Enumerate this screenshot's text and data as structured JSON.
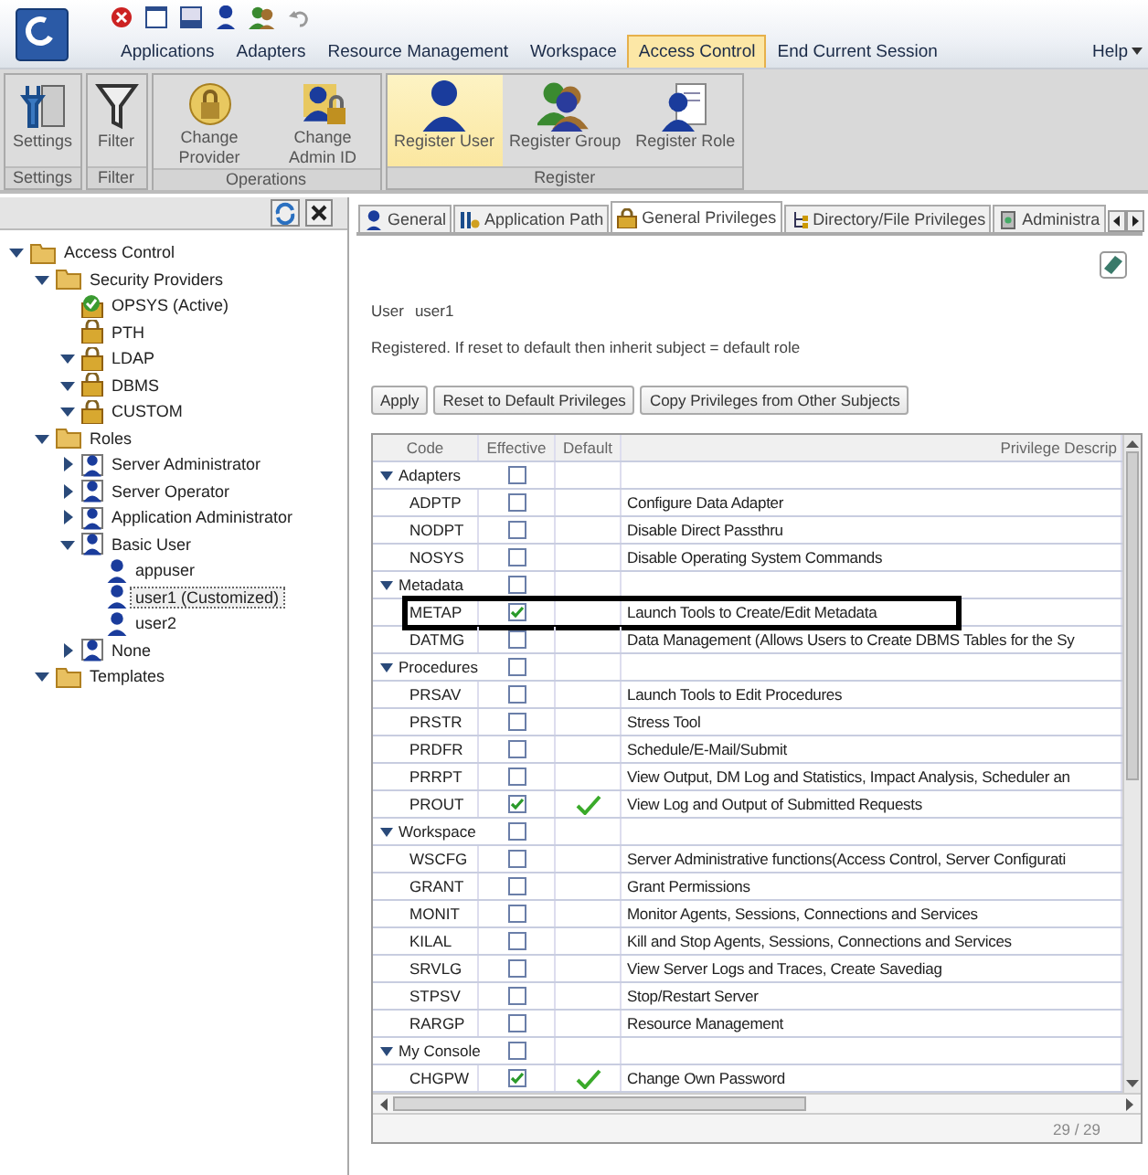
{
  "menu": {
    "items": [
      {
        "label": "Applications",
        "selected": false
      },
      {
        "label": "Adapters",
        "selected": false
      },
      {
        "label": "Resource Management",
        "selected": false
      },
      {
        "label": "Workspace",
        "selected": false
      },
      {
        "label": "Access Control",
        "selected": true
      },
      {
        "label": "End Current Session",
        "selected": false
      }
    ],
    "help": "Help"
  },
  "ribbon": [
    {
      "label": "Settings",
      "items": [
        {
          "label": "Settings",
          "kind": "settings",
          "selected": false
        }
      ]
    },
    {
      "label": "Filter",
      "items": [
        {
          "label": "Filter",
          "kind": "filter",
          "selected": false
        }
      ]
    },
    {
      "label": "Operations",
      "items": [
        {
          "label": "Change Provider",
          "kind": "provider",
          "selected": false
        },
        {
          "label": "Change Admin ID",
          "kind": "admin",
          "selected": false
        }
      ]
    },
    {
      "label": "Register",
      "items": [
        {
          "label": "Register User",
          "kind": "user",
          "selected": true
        },
        {
          "label": "Register Group",
          "kind": "group",
          "selected": false
        },
        {
          "label": "Register Role",
          "kind": "role",
          "selected": false
        }
      ]
    }
  ],
  "tree": [
    {
      "label": "Access Control",
      "kind": "folder",
      "expanded": true,
      "selected": false,
      "children": [
        {
          "label": "Security Providers",
          "kind": "folder",
          "expanded": true,
          "selected": false,
          "children": [
            {
              "label": "OPSYS (Active)",
              "kind": "provider-active",
              "selected": false
            },
            {
              "label": "PTH",
              "kind": "provider",
              "selected": false
            },
            {
              "label": "LDAP",
              "kind": "provider",
              "expanded": true,
              "selected": false
            },
            {
              "label": "DBMS",
              "kind": "provider",
              "expanded": true,
              "selected": false
            },
            {
              "label": "CUSTOM",
              "kind": "provider",
              "expanded": true,
              "selected": false
            }
          ]
        },
        {
          "label": "Roles",
          "kind": "folder",
          "expanded": true,
          "selected": false,
          "children": [
            {
              "label": "Server Administrator",
              "kind": "role",
              "expanded": false,
              "selected": false
            },
            {
              "label": "Server Operator",
              "kind": "role",
              "expanded": false,
              "selected": false
            },
            {
              "label": "Application Administrator",
              "kind": "role",
              "expanded": false,
              "selected": false
            },
            {
              "label": "Basic User",
              "kind": "role",
              "expanded": true,
              "selected": false,
              "children": [
                {
                  "label": "appuser",
                  "kind": "user",
                  "selected": false
                },
                {
                  "label": "user1 (Customized)",
                  "kind": "user",
                  "selected": true
                },
                {
                  "label": "user2",
                  "kind": "user",
                  "selected": false
                }
              ]
            },
            {
              "label": "None",
              "kind": "role",
              "expanded": false,
              "selected": false
            }
          ]
        },
        {
          "label": "Templates",
          "kind": "folder",
          "expanded": true,
          "selected": false
        }
      ]
    }
  ],
  "tabs": [
    {
      "label": "General",
      "kind": "person",
      "selected": false
    },
    {
      "label": "Application Path",
      "kind": "tools",
      "selected": false
    },
    {
      "label": "General Privileges",
      "kind": "lock",
      "selected": true
    },
    {
      "label": "Directory/File Privileges",
      "kind": "tree",
      "selected": false
    },
    {
      "label": "Administra",
      "kind": "server",
      "selected": false
    }
  ],
  "user_label": "User",
  "user_value": "user1",
  "status_text": "Registered. If reset to default then inherit subject = default role",
  "buttons": [
    "Apply",
    "Reset to Default Privileges",
    "Copy Privileges from Other Subjects"
  ],
  "table": {
    "columns": [
      "Code",
      "Effective",
      "Default",
      "Privilege Descrip"
    ],
    "rows": [
      {
        "kind": "group",
        "label": "Adapters",
        "expanded": true,
        "effective": false
      },
      {
        "kind": "privilege",
        "code": "ADPTP",
        "effective": false,
        "default": false,
        "description": "Configure Data Adapter",
        "highlighted": false
      },
      {
        "kind": "privilege",
        "code": "NODPT",
        "effective": false,
        "default": false,
        "description": "Disable Direct Passthru",
        "highlighted": false
      },
      {
        "kind": "privilege",
        "code": "NOSYS",
        "effective": false,
        "default": false,
        "description": "Disable Operating System Commands",
        "highlighted": false
      },
      {
        "kind": "group",
        "label": "Metadata",
        "expanded": true,
        "effective": false
      },
      {
        "kind": "privilege",
        "code": "METAP",
        "effective": true,
        "default": false,
        "description": "Launch Tools to Create/Edit Metadata",
        "highlighted": true
      },
      {
        "kind": "privilege",
        "code": "DATMG",
        "effective": false,
        "default": false,
        "description": "Data Management (Allows Users to Create DBMS Tables for the Sy",
        "highlighted": false
      },
      {
        "kind": "group",
        "label": "Procedures",
        "expanded": true,
        "effective": false
      },
      {
        "kind": "privilege",
        "code": "PRSAV",
        "effective": false,
        "default": false,
        "description": "Launch Tools to Edit Procedures",
        "highlighted": false
      },
      {
        "kind": "privilege",
        "code": "PRSTR",
        "effective": false,
        "default": false,
        "description": "Stress Tool",
        "highlighted": false
      },
      {
        "kind": "privilege",
        "code": "PRDFR",
        "effective": false,
        "default": false,
        "description": "Schedule/E-Mail/Submit",
        "highlighted": false
      },
      {
        "kind": "privilege",
        "code": "PRRPT",
        "effective": false,
        "default": false,
        "description": "View Output, DM Log and Statistics, Impact Analysis, Scheduler an",
        "highlighted": false
      },
      {
        "kind": "privilege",
        "code": "PROUT",
        "effective": true,
        "default": true,
        "description": "View Log and Output of Submitted Requests",
        "highlighted": false
      },
      {
        "kind": "group",
        "label": "Workspace",
        "expanded": true,
        "effective": false
      },
      {
        "kind": "privilege",
        "code": "WSCFG",
        "effective": false,
        "default": false,
        "description": "Server Administrative functions(Access Control, Server Configurati",
        "highlighted": false
      },
      {
        "kind": "privilege",
        "code": "GRANT",
        "effective": false,
        "default": false,
        "description": "Grant Permissions",
        "highlighted": false
      },
      {
        "kind": "privilege",
        "code": "MONIT",
        "effective": false,
        "default": false,
        "description": "Monitor Agents, Sessions, Connections and Services",
        "highlighted": false
      },
      {
        "kind": "privilege",
        "code": "KILAL",
        "effective": false,
        "default": false,
        "description": "Kill and Stop Agents, Sessions, Connections and Services",
        "highlighted": false
      },
      {
        "kind": "privilege",
        "code": "SRVLG",
        "effective": false,
        "default": false,
        "description": "View Server Logs and Traces, Create Savediag",
        "highlighted": false
      },
      {
        "kind": "privilege",
        "code": "STPSV",
        "effective": false,
        "default": false,
        "description": "Stop/Restart Server",
        "highlighted": false
      },
      {
        "kind": "privilege",
        "code": "RARGP",
        "effective": false,
        "default": false,
        "description": "Resource Management",
        "highlighted": false
      },
      {
        "kind": "group",
        "label": "My Console",
        "expanded": true,
        "effective": false
      },
      {
        "kind": "privilege",
        "code": "CHGPW",
        "effective": true,
        "default": true,
        "description": "Change Own Password",
        "highlighted": false
      }
    ]
  },
  "count": "29 / 29"
}
